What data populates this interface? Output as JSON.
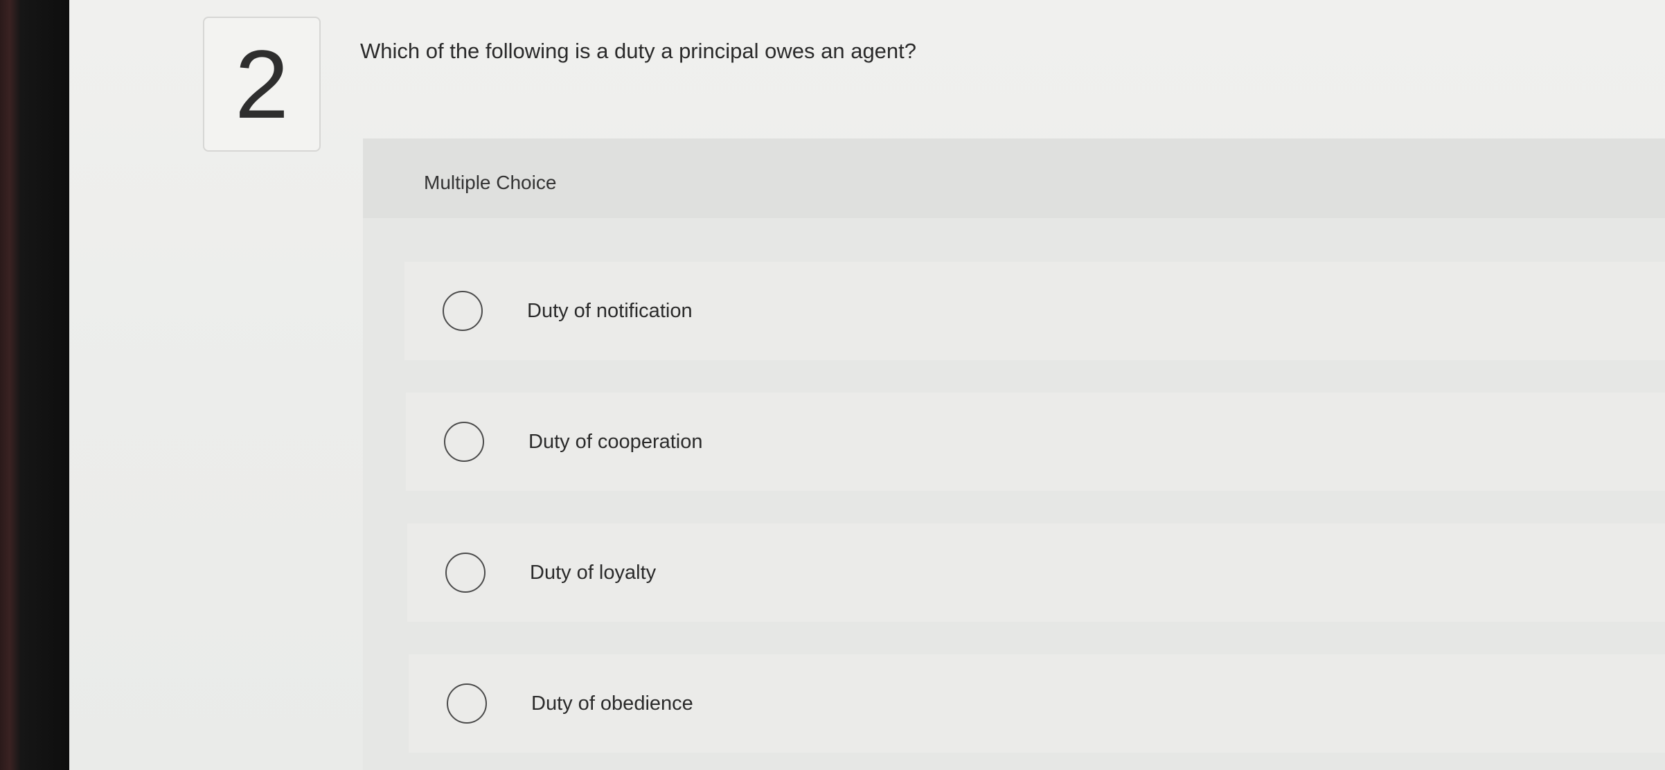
{
  "question": {
    "number": "2",
    "text": "Which of the following is a duty a principal owes an agent?"
  },
  "answer_section": {
    "type_label": "Multiple Choice",
    "choices": [
      {
        "label": "Duty of notification",
        "selected": false
      },
      {
        "label": "Duty of cooperation",
        "selected": false
      },
      {
        "label": "Duty of loyalty",
        "selected": false
      },
      {
        "label": "Duty of obedience",
        "selected": false
      }
    ]
  }
}
